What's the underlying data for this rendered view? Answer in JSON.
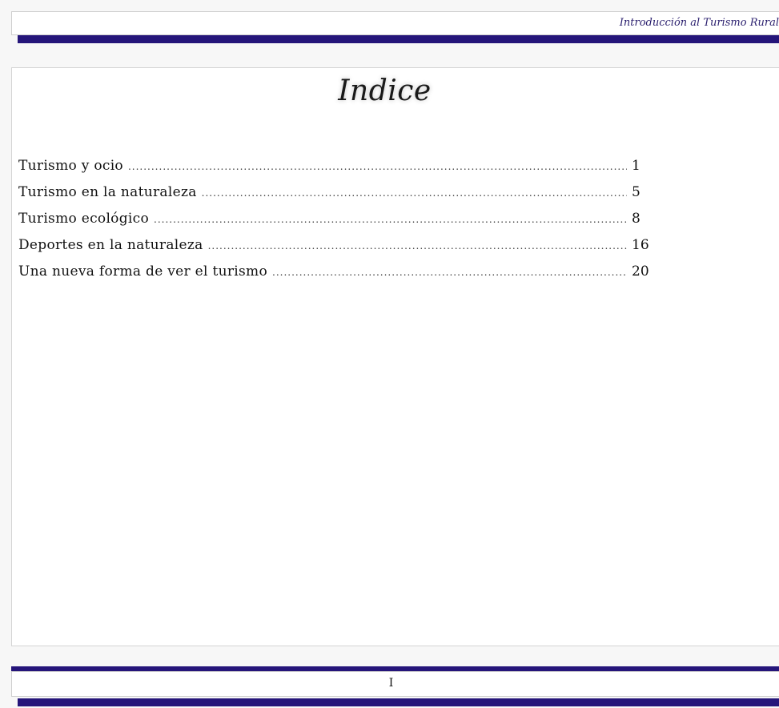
{
  "header": {
    "running_title": "Introducción al Turismo Rural"
  },
  "main": {
    "title": "Indice",
    "toc": [
      {
        "label": "Turismo y ocio",
        "page": "1"
      },
      {
        "label": "Turismo en la naturaleza",
        "page": "5"
      },
      {
        "label": "Turismo ecológico",
        "page": "8"
      },
      {
        "label": "Deportes en la naturaleza",
        "page": "16"
      },
      {
        "label": "Una nueva forma de ver el turismo",
        "page": "20"
      }
    ]
  },
  "footer": {
    "page_number": "I"
  },
  "colors": {
    "accent_rule": "#25157a",
    "header_text": "#2a1f6e"
  }
}
